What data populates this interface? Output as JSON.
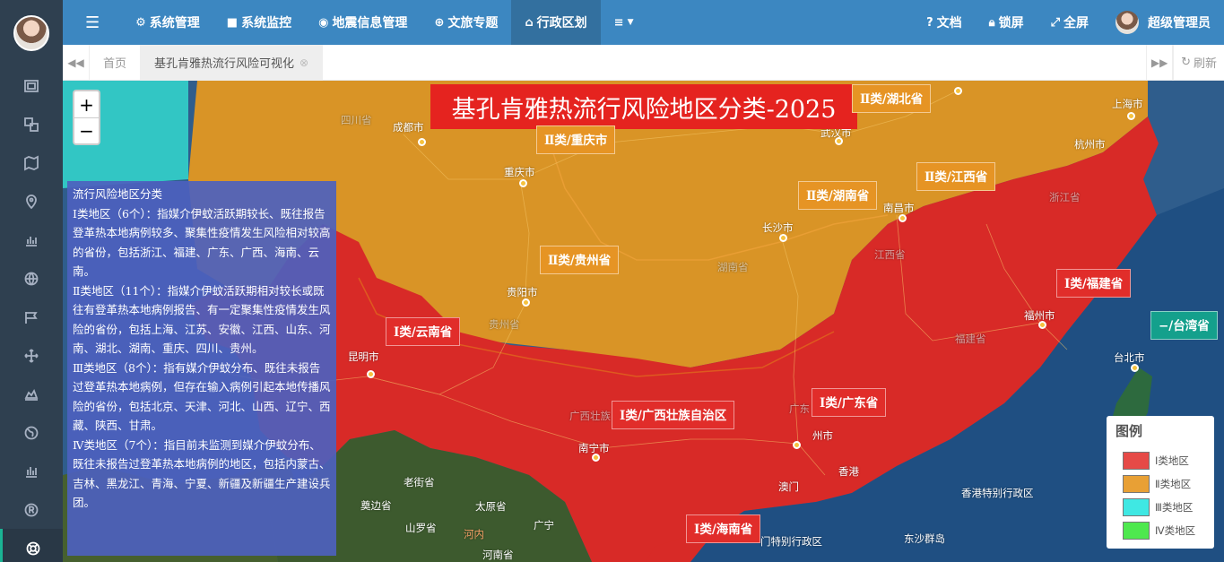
{
  "topbar": {
    "menu": [
      {
        "icon": "gear-icon",
        "label": "系统管理"
      },
      {
        "icon": "video-icon",
        "label": "系统监控"
      },
      {
        "icon": "map-marker-icon",
        "label": "地震信息管理"
      },
      {
        "icon": "globe-icon",
        "label": "文旅专题"
      },
      {
        "icon": "bank-icon",
        "label": "行政区划"
      }
    ],
    "docs": "文档",
    "lock": "锁屏",
    "fullscreen": "全屏",
    "user": "超级管理员"
  },
  "tabs": {
    "home": "首页",
    "current": "基孔肯雅热流行风险可视化",
    "refresh": "刷新"
  },
  "map": {
    "title": "基孔肯雅热流行风险地区分类-2025",
    "zoom_in": "+",
    "zoom_out": "−",
    "description": [
      "流行风险地区分类",
      "Ⅰ类地区（6个）：指媒介伊蚊活跃期较长、既往报告登革热本地病例较多、聚集性疫情发生风险相对较高的省份，包括浙江、福建、广东、广西、海南、云南。",
      "Ⅱ类地区（11个）：指媒介伊蚊活跃期相对较长或既往有登革热本地病例报告、有一定聚集性疫情发生风险的省份，包括上海、江苏、安徽、江西、山东、河南、湖北、湖南、重庆、四川、贵州。",
      "Ⅲ类地区（8个）：指有媒介伊蚊分布、既往未报告过登革热本地病例，但存在输入病例引起本地传播风险的省份，包括北京、天津、河北、山西、辽宁、西藏、陕西、甘肃。",
      "Ⅳ类地区（7个）：指目前未监测到媒介伊蚊分布、既往未报告过登革热本地病例的地区，包括内蒙古、吉林、黑龙江、青海、宁夏、新疆及新疆生产建设兵团。"
    ],
    "region_labels": {
      "hubei": "Ⅱ类/湖北省",
      "chongqing": "Ⅱ类/重庆市",
      "jiangxi": "Ⅱ类/江西省",
      "hunan": "Ⅱ类/湖南省",
      "guizhou": "Ⅱ类/贵州省",
      "fujian": "Ⅰ类/福建省",
      "taiwan": "−/台湾省",
      "yunnan": "Ⅰ类/云南省",
      "guangxi": "Ⅰ类/广西壮族自治区",
      "guangdong": "Ⅰ类/广东省",
      "hainan": "Ⅰ类/海南省"
    },
    "cities": {
      "chengdu": "成都市",
      "chongqing": "重庆市",
      "changsha": "长沙市",
      "nanchang": "南昌市",
      "wuhan": "武汉市",
      "shanghai": "上海市",
      "hangzhou": "杭州市",
      "guiyang": "贵阳市",
      "kunming": "昆明市",
      "nanning": "南宁市",
      "guangzhou": "州市",
      "fuzhou": "福州市",
      "taipei": "台北市",
      "hongkong": "香港",
      "macau": "澳门",
      "hk_sar": "香港特别行政区",
      "macau_sar": "门特别行政区",
      "dongsha": "东沙群岛",
      "hanoi": "河内"
    },
    "provinces": {
      "sichuan": "四川省",
      "guizhou": "贵州省",
      "hunan": "湖南省",
      "jiangxi": "江西省",
      "zhejiang": "浙江省",
      "fujian": "福建省",
      "guangxi": "广西壮族",
      "guangdong": "广东",
      "laojie": "老街省",
      "taiyuan": "太原省",
      "guangning": "广宁",
      "dianbian": "奠边省",
      "shanluo": "山罗省",
      "henan_vn": "河南省"
    },
    "legend": {
      "title": "图例",
      "items": [
        {
          "label": "Ⅰ类地区",
          "color": "#e64a47"
        },
        {
          "label": "Ⅱ类地区",
          "color": "#e8a035"
        },
        {
          "label": "Ⅲ类地区",
          "color": "#3fe8e3"
        },
        {
          "label": "Ⅳ类地区",
          "color": "#4ee84e"
        }
      ]
    }
  }
}
